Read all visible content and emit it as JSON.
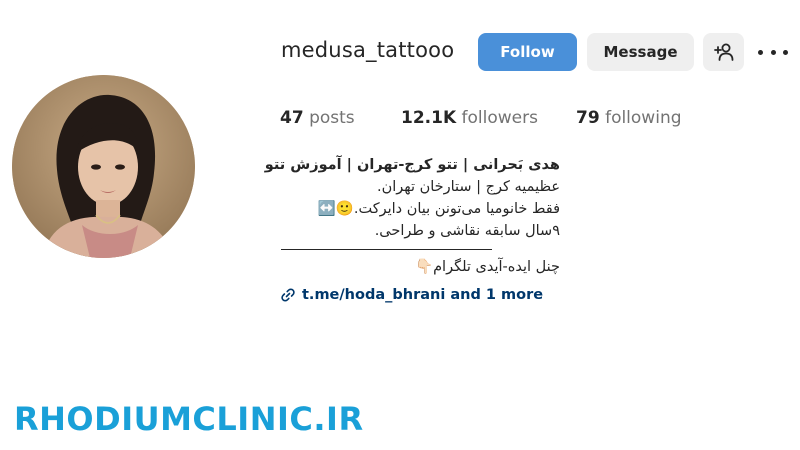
{
  "profile": {
    "username": "medusa_tattooo",
    "follow_label": "Follow",
    "message_label": "Message"
  },
  "stats": {
    "posts_count": "47",
    "posts_label": "posts",
    "followers_count": "12.1K",
    "followers_label": "followers",
    "following_count": "79",
    "following_label": "following"
  },
  "bio": {
    "name": "هدی بَحرانی | تتو کرج-تهران | آموزش تتو",
    "line1": "عظیمیه کرج | ستارخان تهران.",
    "line2": "فقط خانومیا می‌تونن بیان دایرکت.🙂↔️",
    "line3": "۹سال سابقه نقاشی و طراحی.",
    "line4": "چنل ایده-آیدی تلگرام👇🏻"
  },
  "link": {
    "text": "t.me/hoda_bhrani and 1 more"
  },
  "watermark": "RHODIUMCLINIC.IR",
  "colors": {
    "follow_button": "#4a90d9",
    "secondary_button": "#efefef",
    "link": "#00376b",
    "watermark": "#1aa0d8"
  },
  "icons": {
    "add_user": "person-plus-icon",
    "more": "more-options-icon",
    "link": "link-chain-icon"
  }
}
